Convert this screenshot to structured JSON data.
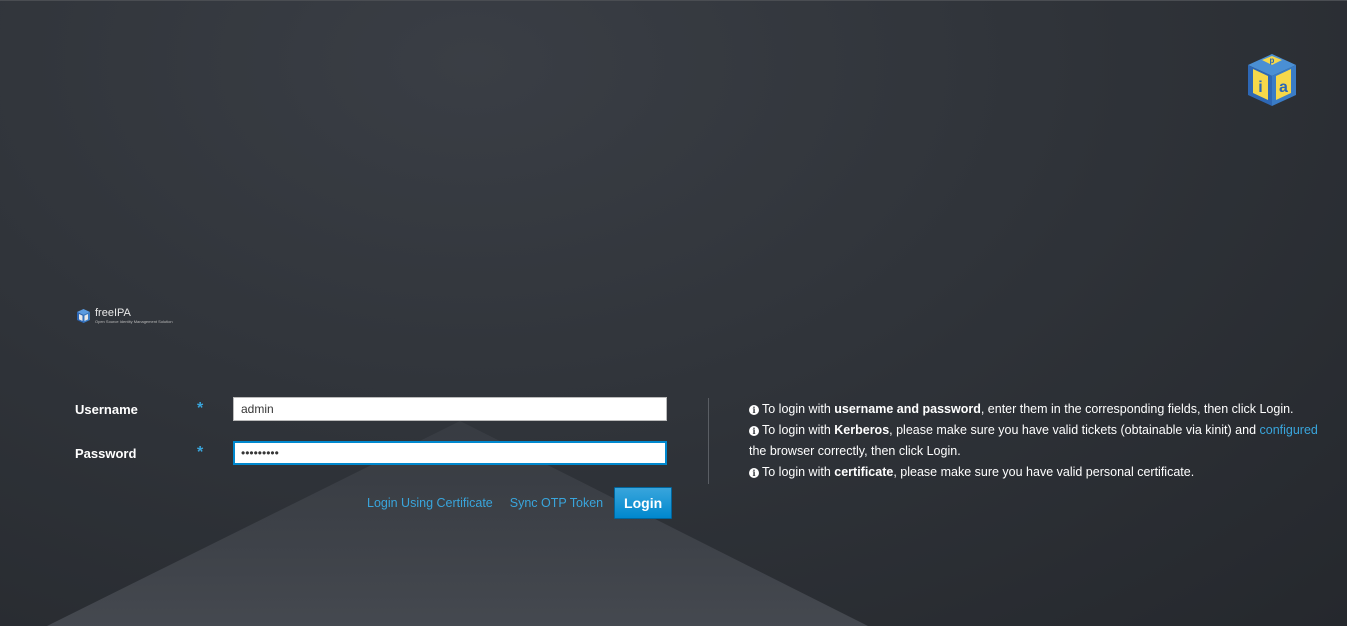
{
  "brand": {
    "name": "freeIPA",
    "tagline": "Open Source Identity Management Solution",
    "top_logo_letters": [
      "i",
      "p",
      "a"
    ]
  },
  "colors": {
    "accent": "#39a5dc",
    "button": "#0088ce",
    "background": "#30343a"
  },
  "form": {
    "username": {
      "label": "Username",
      "required_mark": "*",
      "value": "admin"
    },
    "password": {
      "label": "Password",
      "required_mark": "*",
      "value": "•••••••••"
    }
  },
  "actions": {
    "cert_login": "Login Using Certificate",
    "sync_otp": "Sync OTP Token",
    "login": "Login"
  },
  "info": {
    "icon": "info-circle-icon",
    "line1": {
      "pre": "To login with ",
      "bold": "username and password",
      "post": ", enter them in the corresponding fields, then click Login."
    },
    "line2": {
      "pre": "To login with ",
      "bold": "Kerberos",
      "mid": ", please make sure you have valid tickets (obtainable via kinit) and ",
      "link": "configured",
      "post": " the browser correctly, then click Login."
    },
    "line3": {
      "pre": "To login with ",
      "bold": "certificate",
      "post": ", please make sure you have valid personal certificate."
    }
  }
}
